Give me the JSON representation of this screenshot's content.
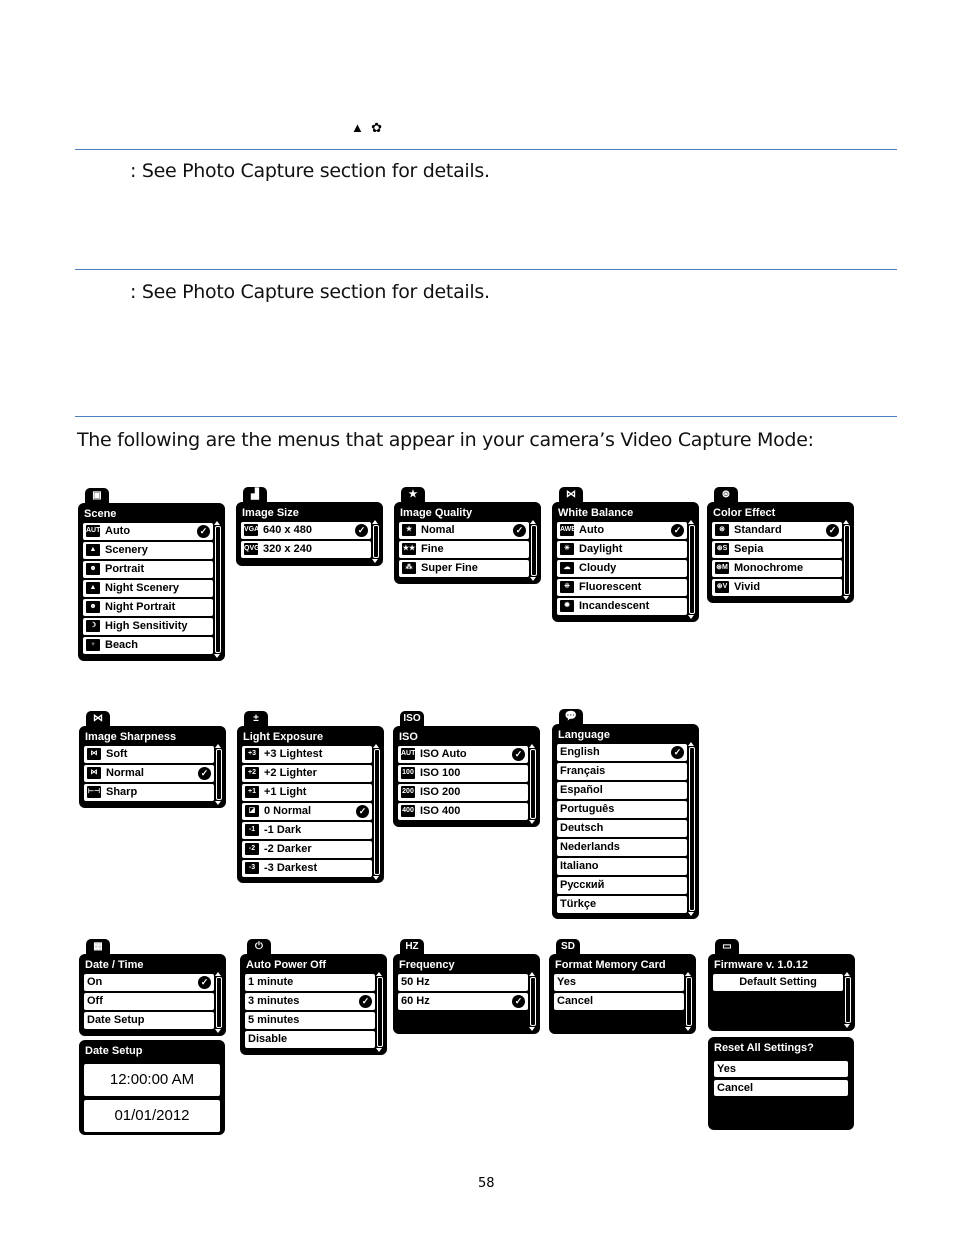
{
  "page": {
    "top_icons": [
      "mountain-icon",
      "macro-flower-icon"
    ],
    "section1_text": ": See Photo Capture section for details.",
    "section2_text": ": See Photo Capture section for details.",
    "intro_text": "The following are the menus that appear in your camera’s Video Capture Mode:",
    "page_number": "58",
    "rule_color": "#4f81bd"
  },
  "menus": {
    "scene": {
      "tab_icon": "scene-icon",
      "tab_glyph": "▣",
      "title": "Scene",
      "items": [
        {
          "icon": "AUTO",
          "label": "Auto",
          "selected": true
        },
        {
          "icon": "▲",
          "label": "Scenery"
        },
        {
          "icon": "☻",
          "label": "Portrait"
        },
        {
          "icon": "▲",
          "label": "Night Scenery"
        },
        {
          "icon": "☻",
          "label": "Night Portrait"
        },
        {
          "icon": "☽",
          "label": "High Sensitivity"
        },
        {
          "icon": "♆",
          "label": "Beach"
        }
      ]
    },
    "image_size": {
      "tab_icon": "image-size-icon",
      "tab_glyph": "▟",
      "title": "Image Size",
      "items": [
        {
          "icon": "VGA",
          "label": "640 x 480",
          "selected": true
        },
        {
          "icon": "QVGA",
          "label": "320 x 240"
        }
      ]
    },
    "image_quality": {
      "tab_icon": "star-icon",
      "tab_glyph": "★",
      "title": "Image Quality",
      "items": [
        {
          "icon": "★",
          "label": "Nomal",
          "selected": true
        },
        {
          "icon": "★★",
          "label": "Fine"
        },
        {
          "icon": "⁂",
          "label": "Super Fine"
        }
      ]
    },
    "white_balance": {
      "tab_icon": "white-balance-icon",
      "tab_glyph": "⋈",
      "title": "White Balance",
      "items": [
        {
          "icon": "AWB",
          "label": "Auto",
          "selected": true
        },
        {
          "icon": "☀",
          "label": "Daylight"
        },
        {
          "icon": "☁",
          "label": "Cloudy"
        },
        {
          "icon": "⁜",
          "label": "Fluorescent"
        },
        {
          "icon": "✹",
          "label": "Incandescent"
        }
      ]
    },
    "color_effect": {
      "tab_icon": "color-effect-icon",
      "tab_glyph": "⊛",
      "title": "Color Effect",
      "items": [
        {
          "icon": "⊛",
          "label": "Standard",
          "selected": true
        },
        {
          "icon": "⊛S",
          "label": "Sepia"
        },
        {
          "icon": "⊛M",
          "label": "Monochrome"
        },
        {
          "icon": "⊛V",
          "label": "Vivid"
        }
      ]
    },
    "image_sharpness": {
      "tab_icon": "sharpness-icon",
      "tab_glyph": "⋈",
      "title": "Image Sharpness",
      "items": [
        {
          "icon": "⋈",
          "label": "Soft"
        },
        {
          "icon": "⋈",
          "label": "Normal",
          "selected": true
        },
        {
          "icon": "⊢⊣",
          "label": "Sharp"
        }
      ]
    },
    "light_exposure": {
      "tab_icon": "exposure-icon",
      "tab_glyph": "±",
      "title": "Light Exposure",
      "items": [
        {
          "icon": "+3",
          "label": "+3 Lightest"
        },
        {
          "icon": "+2",
          "label": "+2 Lighter"
        },
        {
          "icon": "+1",
          "label": "+1 Light"
        },
        {
          "icon": "◪",
          "label": "0 Normal",
          "selected": true
        },
        {
          "icon": "-1",
          "label": "-1 Dark"
        },
        {
          "icon": "-2",
          "label": "-2 Darker"
        },
        {
          "icon": "-3",
          "label": "-3 Darkest"
        }
      ]
    },
    "iso": {
      "tab_icon": "iso-icon",
      "tab_glyph": "ISO",
      "title": "ISO",
      "items": [
        {
          "icon": "AUTO",
          "label": "ISO Auto",
          "selected": true
        },
        {
          "icon": "100",
          "label": "ISO 100"
        },
        {
          "icon": "200",
          "label": "ISO 200"
        },
        {
          "icon": "400",
          "label": "ISO 400"
        }
      ]
    },
    "language": {
      "tab_icon": "speech-bubble-icon",
      "tab_glyph": "💬",
      "title": "Language",
      "items": [
        {
          "label": "English",
          "selected": true
        },
        {
          "label": "Français"
        },
        {
          "label": "Español"
        },
        {
          "label": "Português"
        },
        {
          "label": "Deutsch"
        },
        {
          "label": "Nederlands"
        },
        {
          "label": "Italiano"
        },
        {
          "label": "Русский"
        },
        {
          "label": "Türkçe"
        }
      ]
    },
    "date_time": {
      "tab_icon": "calendar-icon",
      "tab_glyph": "▦",
      "title": "Date / Time",
      "items": [
        {
          "label": "On",
          "selected": true
        },
        {
          "label": "Off"
        },
        {
          "label": "Date Setup"
        }
      ]
    },
    "date_setup": {
      "title": "Date Setup",
      "time": "12:00:00 AM",
      "date": "01/01/2012"
    },
    "auto_power_off": {
      "tab_icon": "power-icon",
      "tab_glyph": "⏻",
      "title": "Auto Power Off",
      "items": [
        {
          "label": "1 minute"
        },
        {
          "label": "3 minutes",
          "selected": true
        },
        {
          "label": "5 minutes"
        },
        {
          "label": "Disable"
        }
      ]
    },
    "frequency": {
      "tab_icon": "hz-icon",
      "tab_glyph": "HZ",
      "title": "Frequency",
      "items": [
        {
          "label": "50 Hz"
        },
        {
          "label": "60 Hz",
          "selected": true
        }
      ]
    },
    "format_memory_card": {
      "tab_icon": "sd-card-icon",
      "tab_glyph": "SD",
      "title": "Format Memory Card",
      "items": [
        {
          "label": "Yes"
        },
        {
          "label": "Cancel"
        }
      ]
    },
    "firmware": {
      "tab_icon": "window-icon",
      "tab_glyph": "▭",
      "title": "Firmware v. 1.0.12",
      "items": [
        {
          "label": "Default Setting"
        }
      ]
    },
    "reset_all": {
      "title": "Reset All Settings?",
      "items": [
        {
          "label": "Yes"
        },
        {
          "label": "Cancel"
        }
      ]
    }
  }
}
